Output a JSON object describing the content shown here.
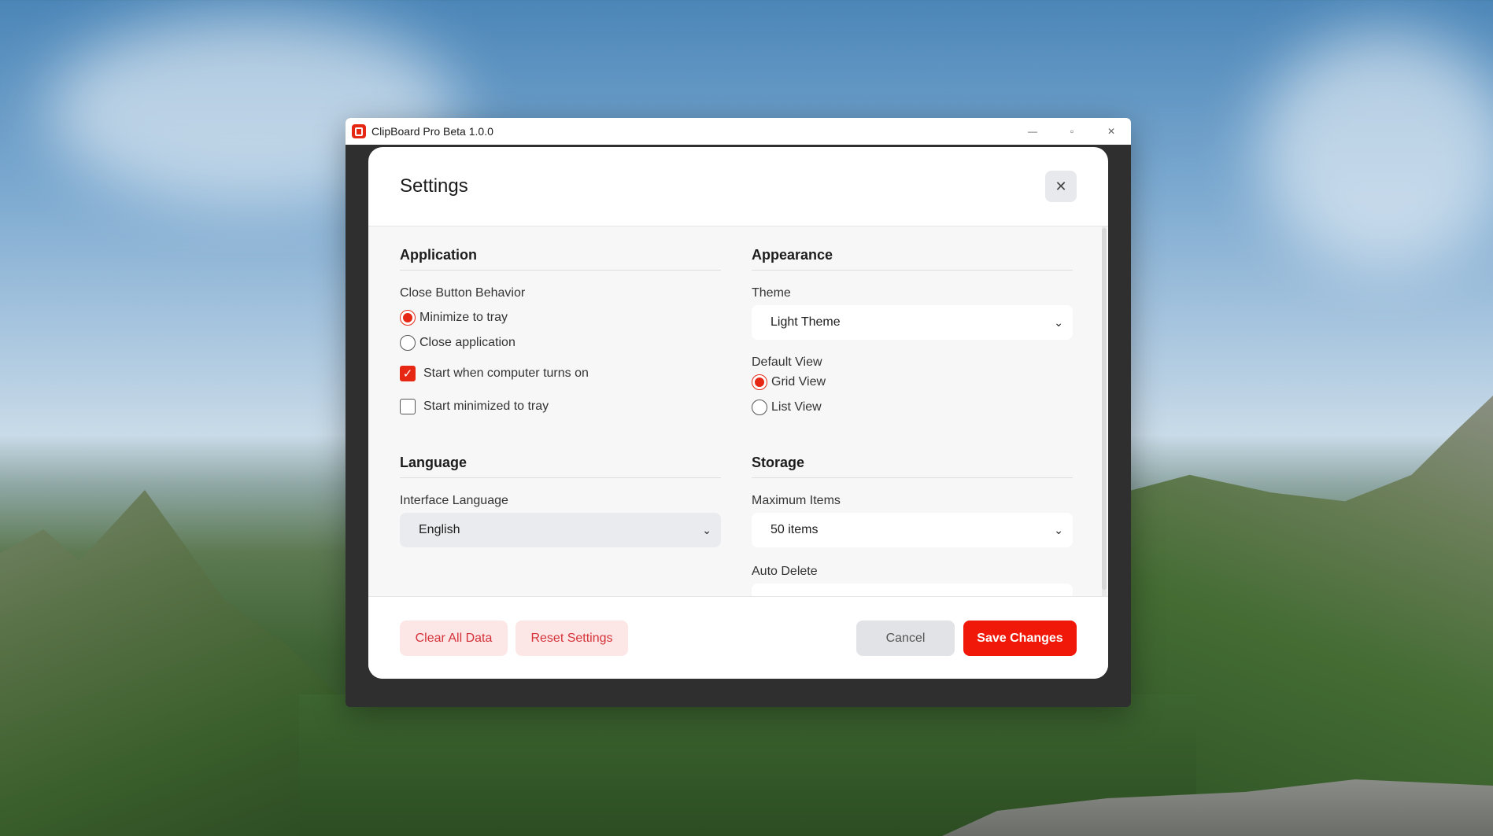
{
  "window": {
    "title": "ClipBoard Pro Beta 1.0.0",
    "controls": {
      "minimize": "—",
      "maximize": "▫",
      "close": "✕"
    }
  },
  "modal": {
    "title": "Settings",
    "close_label": "✕"
  },
  "application": {
    "section_title": "Application",
    "close_behavior_label": "Close Button Behavior",
    "close_behavior_options": [
      "Minimize to tray",
      "Close application"
    ],
    "close_behavior_selected": "Minimize to tray",
    "start_on_boot_label": "Start when computer turns on",
    "start_on_boot_checked": true,
    "start_minimized_label": "Start minimized to tray",
    "start_minimized_checked": false
  },
  "appearance": {
    "section_title": "Appearance",
    "theme_label": "Theme",
    "theme_value": "Light Theme",
    "default_view_label": "Default View",
    "default_view_options": [
      "Grid View",
      "List View"
    ],
    "default_view_selected": "Grid View"
  },
  "language": {
    "section_title": "Language",
    "interface_language_label": "Interface Language",
    "interface_language_value": "English"
  },
  "storage": {
    "section_title": "Storage",
    "max_items_label": "Maximum Items",
    "max_items_value": "50 items",
    "auto_delete_label": "Auto Delete"
  },
  "footer": {
    "clear_all_label": "Clear All Data",
    "reset_label": "Reset Settings",
    "cancel_label": "Cancel",
    "save_label": "Save Changes"
  },
  "colors": {
    "accent": "#e62714",
    "primary_button": "#f01808",
    "danger_soft_bg": "#fde6e6",
    "danger_text": "#d4333a"
  },
  "icons": {
    "app": "clipboard-icon",
    "chevron": "chevron-down-icon",
    "check": "checkmark-icon"
  }
}
